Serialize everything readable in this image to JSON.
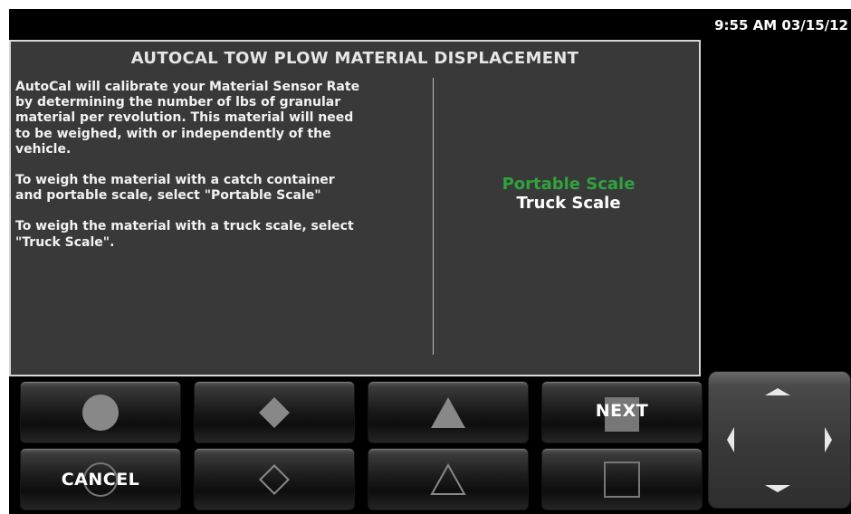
{
  "status": {
    "time": "9:55 AM 03/15/12"
  },
  "panel": {
    "title": "AUTOCAL TOW PLOW MATERIAL DISPLACEMENT",
    "paragraphs": [
      "AutoCal will calibrate your Material Sensor Rate\nby determining the number of lbs of granular\nmaterial per revolution. This material will need\nto be weighed, with or independently of the\nvehicle.",
      "To weigh the material with a catch container\nand portable scale, select \"Portable Scale\"",
      "To weigh the material with a truck scale, select\n\"Truck Scale\"."
    ],
    "options": [
      {
        "label": "Portable Scale",
        "selected": true
      },
      {
        "label": "Truck Scale",
        "selected": false
      }
    ]
  },
  "buttons": {
    "next_label": "NEXT",
    "cancel_label": "CANCEL",
    "icons": [
      "circle-filled",
      "diamond-filled",
      "triangle-filled",
      "square-filled",
      "circle-outline",
      "diamond-outline",
      "triangle-outline",
      "square-outline"
    ]
  },
  "dpad": {
    "arrows": [
      "up",
      "down",
      "left",
      "right"
    ]
  },
  "colors": {
    "selected": "#2fa33d",
    "panel_bg": "#393939",
    "screen_bg": "#000000"
  }
}
